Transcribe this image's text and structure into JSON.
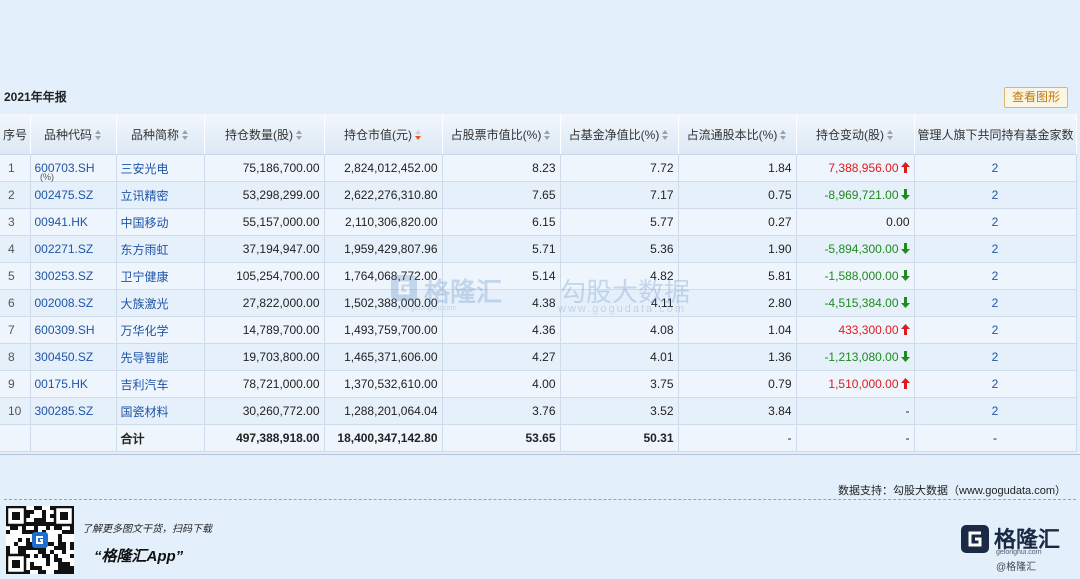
{
  "report": {
    "title": "2021年年报",
    "view_chart_button": "查看图形"
  },
  "table": {
    "headers": {
      "rank": "序号",
      "code": "品种代码",
      "name": "品种简称",
      "shares": "持仓数量(股)",
      "value": "持仓市值(元)",
      "pct_stock": "占股票市值比(%)",
      "pct_nav": "占基金净值比(%)",
      "pct_float": "占流通股本比(%)",
      "change": "持仓变动(股)",
      "fund_count": "管理人旗下共同持有基金家数"
    },
    "pct_subscript": "(%)",
    "rows": [
      {
        "rank": "1",
        "code": "600703.SH",
        "name": "三安光电",
        "shares": "75,186,700.00",
        "value": "2,824,012,452.00",
        "pct_stock": "8.23",
        "pct_nav": "7.72",
        "pct_float": "1.84",
        "change": "7,388,956.00",
        "dir": "up",
        "funds": "2"
      },
      {
        "rank": "2",
        "code": "002475.SZ",
        "name": "立讯精密",
        "shares": "53,298,299.00",
        "value": "2,622,276,310.80",
        "pct_stock": "7.65",
        "pct_nav": "7.17",
        "pct_float": "0.75",
        "change": "-8,969,721.00",
        "dir": "down",
        "funds": "2"
      },
      {
        "rank": "3",
        "code": "00941.HK",
        "name": "中国移动",
        "shares": "55,157,000.00",
        "value": "2,110,306,820.00",
        "pct_stock": "6.15",
        "pct_nav": "5.77",
        "pct_float": "0.27",
        "change": "0.00",
        "dir": "none",
        "funds": "2"
      },
      {
        "rank": "4",
        "code": "002271.SZ",
        "name": "东方雨虹",
        "shares": "37,194,947.00",
        "value": "1,959,429,807.96",
        "pct_stock": "5.71",
        "pct_nav": "5.36",
        "pct_float": "1.90",
        "change": "-5,894,300.00",
        "dir": "down",
        "funds": "2"
      },
      {
        "rank": "5",
        "code": "300253.SZ",
        "name": "卫宁健康",
        "shares": "105,254,700.00",
        "value": "1,764,068,772.00",
        "pct_stock": "5.14",
        "pct_nav": "4.82",
        "pct_float": "5.81",
        "change": "-1,588,000.00",
        "dir": "down",
        "funds": "2"
      },
      {
        "rank": "6",
        "code": "002008.SZ",
        "name": "大族激光",
        "shares": "27,822,000.00",
        "value": "1,502,388,000.00",
        "pct_stock": "4.38",
        "pct_nav": "4.11",
        "pct_float": "2.80",
        "change": "-4,515,384.00",
        "dir": "down",
        "funds": "2"
      },
      {
        "rank": "7",
        "code": "600309.SH",
        "name": "万华化学",
        "shares": "14,789,700.00",
        "value": "1,493,759,700.00",
        "pct_stock": "4.36",
        "pct_nav": "4.08",
        "pct_float": "1.04",
        "change": "433,300.00",
        "dir": "up",
        "funds": "2"
      },
      {
        "rank": "8",
        "code": "300450.SZ",
        "name": "先导智能",
        "shares": "19,703,800.00",
        "value": "1,465,371,606.00",
        "pct_stock": "4.27",
        "pct_nav": "4.01",
        "pct_float": "1.36",
        "change": "-1,213,080.00",
        "dir": "down",
        "funds": "2"
      },
      {
        "rank": "9",
        "code": "00175.HK",
        "name": "吉利汽车",
        "shares": "78,721,000.00",
        "value": "1,370,532,610.00",
        "pct_stock": "4.00",
        "pct_nav": "3.75",
        "pct_float": "0.79",
        "change": "1,510,000.00",
        "dir": "up",
        "funds": "2"
      },
      {
        "rank": "10",
        "code": "300285.SZ",
        "name": "国瓷材料",
        "shares": "30,260,772.00",
        "value": "1,288,201,064.04",
        "pct_stock": "3.76",
        "pct_nav": "3.52",
        "pct_float": "3.84",
        "change": "-",
        "dir": "none",
        "funds": "2"
      }
    ],
    "total": {
      "label": "合计",
      "shares": "497,388,918.00",
      "value": "18,400,347,142.80",
      "pct_stock": "53.65",
      "pct_nav": "50.31",
      "pct_float": "-",
      "change": "-",
      "funds": "-"
    }
  },
  "watermark": {
    "brand": "格隆汇",
    "brand_domain": "www.gelonghui.com",
    "data_brand": "勾股大数据",
    "data_domain": "www.gogudata.com"
  },
  "footer": {
    "support": "数据支持：勾股大数据（www.gogudata.com）",
    "promo_line": "了解更多图文干货，扫码下载",
    "app_name": "“格隆汇App”",
    "brand_name": "格隆汇",
    "brand_domain": "gelonghui.com",
    "brand_sub": "@格隆汇"
  },
  "colors": {
    "up": "#e21a1a",
    "down": "#1f8a1f",
    "link": "#1f55a8",
    "accent": "#e2571b",
    "background": "#e3f0fb"
  }
}
